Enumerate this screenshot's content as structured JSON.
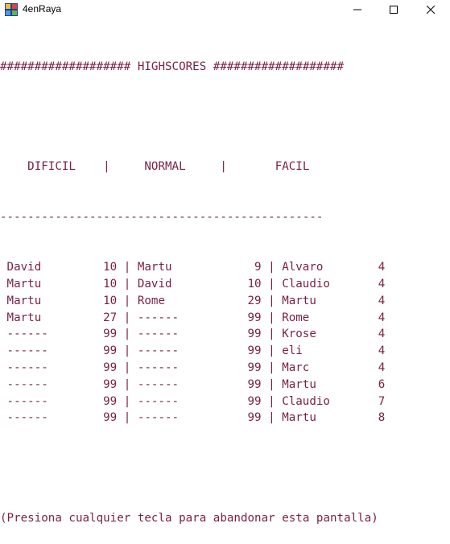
{
  "window": {
    "title": "4enRaya",
    "minimize_icon": "minimize-icon",
    "maximize_icon": "maximize-icon",
    "close_icon": "close-icon"
  },
  "console": {
    "header": "################### HIGHSCORES ###################",
    "columns": [
      "DIFICIL",
      "NORMAL",
      "FACIL"
    ],
    "separator": "-----------------------------------------------",
    "rows": [
      {
        "d_name": "David",
        "d_score": "10",
        "n_name": "Martu",
        "n_score": "9",
        "f_name": "Alvaro",
        "f_score": "4"
      },
      {
        "d_name": "Martu",
        "d_score": "10",
        "n_name": "David",
        "n_score": "10",
        "f_name": "Claudio",
        "f_score": "4"
      },
      {
        "d_name": "Martu",
        "d_score": "10",
        "n_name": "Rome",
        "n_score": "29",
        "f_name": "Martu",
        "f_score": "4"
      },
      {
        "d_name": "Martu",
        "d_score": "27",
        "n_name": "------",
        "n_score": "99",
        "f_name": "Rome",
        "f_score": "4"
      },
      {
        "d_name": "------",
        "d_score": "99",
        "n_name": "------",
        "n_score": "99",
        "f_name": "Krose",
        "f_score": "4"
      },
      {
        "d_name": "------",
        "d_score": "99",
        "n_name": "------",
        "n_score": "99",
        "f_name": "eli",
        "f_score": "4"
      },
      {
        "d_name": "------",
        "d_score": "99",
        "n_name": "------",
        "n_score": "99",
        "f_name": "Marc",
        "f_score": "4"
      },
      {
        "d_name": "------",
        "d_score": "99",
        "n_name": "------",
        "n_score": "99",
        "f_name": "Martu",
        "f_score": "6"
      },
      {
        "d_name": "------",
        "d_score": "99",
        "n_name": "------",
        "n_score": "99",
        "f_name": "Claudio",
        "f_score": "7"
      },
      {
        "d_name": "------",
        "d_score": "99",
        "n_name": "------",
        "n_score": "99",
        "f_name": "Martu",
        "f_score": "8"
      }
    ],
    "footer": "(Presiona cualquier tecla para abandonar esta pantalla)"
  },
  "colors": {
    "console_text": "#7a1f45",
    "background": "#ffffff"
  }
}
